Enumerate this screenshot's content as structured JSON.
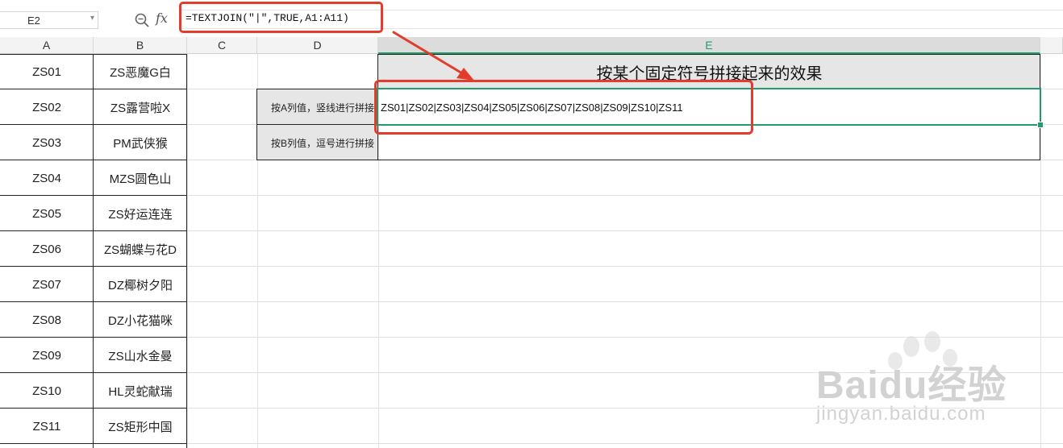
{
  "formula_bar": {
    "cell_ref": "E2",
    "fx_label": "fx",
    "formula": "=TEXTJOIN(\"|\",TRUE,A1:A11)"
  },
  "columns": [
    "A",
    "B",
    "C",
    "D",
    "E"
  ],
  "column_a": [
    "ZS01",
    "ZS02",
    "ZS03",
    "ZS04",
    "ZS05",
    "ZS06",
    "ZS07",
    "ZS08",
    "ZS09",
    "ZS10",
    "ZS11"
  ],
  "column_b": [
    "ZS恶魔G白",
    "ZS露营啦X",
    "PM武侠猴",
    "MZS圆色山",
    "ZS好运连连",
    "ZS蝴蝶与花D",
    "DZ椰树夕阳",
    "DZ小花猫咪",
    "ZS山水金曼",
    "HL灵蛇献瑞",
    "ZS矩形中国"
  ],
  "table": {
    "title": "按某个固定符号拼接起来的效果",
    "row_labels": [
      "按A列值，竖线进行拼接",
      "按B列值，逗号进行拼接"
    ],
    "result_a": "ZS01|ZS02|ZS03|ZS04|ZS05|ZS06|ZS07|ZS08|ZS09|ZS10|ZS11",
    "result_b": ""
  },
  "watermark": {
    "line1": "Baidu经验",
    "line2": "jingyan.baidu.com"
  },
  "colors": {
    "annotation_red": "#e23d2c",
    "selection_green": "#1e9d6a"
  }
}
